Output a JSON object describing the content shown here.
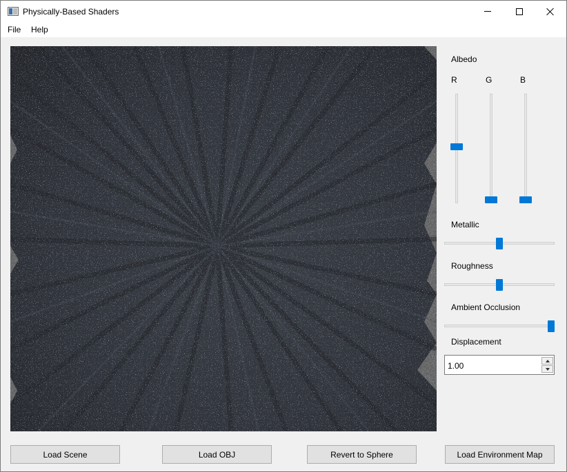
{
  "window": {
    "title": "Physically-Based Shaders",
    "icon": "app-icon",
    "controls": [
      "minimize-icon",
      "maximize-icon",
      "close-icon"
    ]
  },
  "menu": {
    "file": "File",
    "help": "Help"
  },
  "panel": {
    "albedo": {
      "label": "Albedo",
      "r_label": "R",
      "g_label": "G",
      "b_label": "B",
      "r_level": 0.52,
      "g_level": 0.0,
      "b_level": 0.0
    },
    "metallic": {
      "label": "Metallic",
      "level": 0.5
    },
    "roughness": {
      "label": "Roughness",
      "level": 0.5
    },
    "ambient_occlusion": {
      "label": "Ambient Occlusion",
      "level": 1.0
    },
    "displacement": {
      "label": "Displacement",
      "value": "1.00"
    }
  },
  "buttons": {
    "load_scene": "Load Scene",
    "load_obj": "Load OBJ",
    "revert_sphere": "Revert to Sphere",
    "load_env_map": "Load Environment Map"
  },
  "colors": {
    "accent": "#0078d7",
    "viewport_surface": "#2b2d31",
    "viewport_background": "#6b6b6b"
  }
}
